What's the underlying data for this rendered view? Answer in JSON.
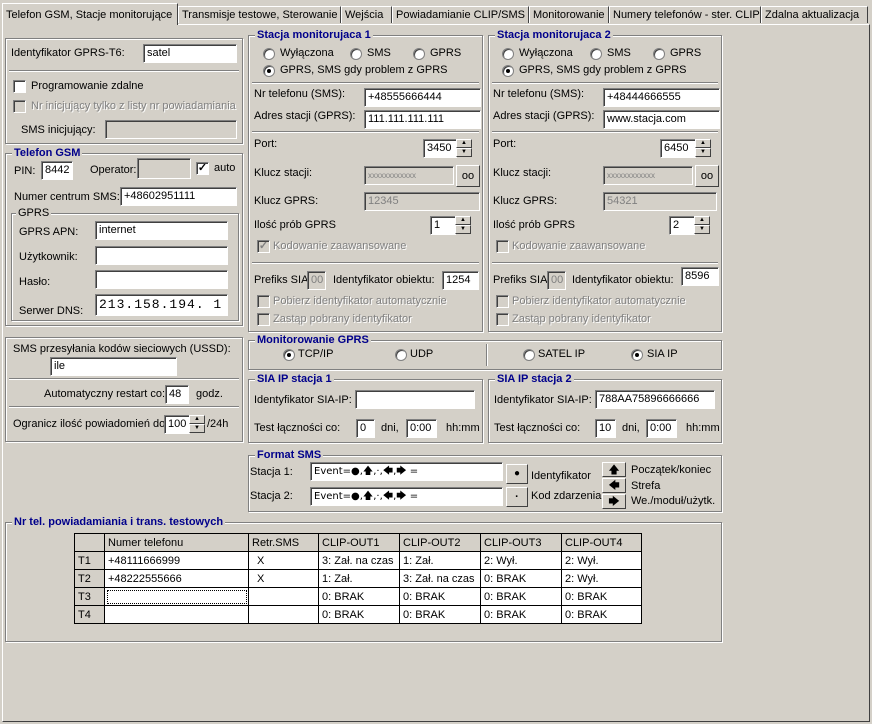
{
  "tabs": [
    "Telefon GSM, Stacje monitorujące",
    "Transmisje testowe, Sterowanie",
    "Wejścia",
    "Powiadamianie CLIP/SMS",
    "Monitorowanie",
    "Numery telefonów - ster. CLIP",
    "Zdalna aktualizacja"
  ],
  "left": {
    "gprs_id_label": "Identyfikator GPRS-T6:",
    "gprs_id_value": "satel",
    "remote_prog_label": "Programowanie zdalne",
    "init_list_label": "Nr inicjujący tylko z listy nr powiadamiania",
    "sms_init_label": "SMS inicjujący:",
    "sms_init_value": ""
  },
  "gsm": {
    "title": "Telefon GSM",
    "pin_label": "PIN:",
    "pin_value": "8442",
    "operator_label": "Operator:",
    "operator_value": "",
    "auto_label": "auto",
    "auto_checked": "✓",
    "center_label": "Numer centrum SMS:",
    "center_value": "+48602951111",
    "gprs_title": "GPRS",
    "apn_label": "GPRS APN:",
    "apn_value": "internet",
    "user_label": "Użytkownik:",
    "user_value": "",
    "pass_label": "Hasło:",
    "pass_value": "",
    "dns_label": "Serwer DNS:",
    "dns_value": "213.158.194.  1"
  },
  "ussd": {
    "label": "SMS przesyłania kodów sieciowych (USSD):",
    "value": "ile"
  },
  "restart": {
    "label": "Automatyczny restart co:",
    "value": "48",
    "unit": "godz."
  },
  "limit": {
    "label": "Ogranicz ilość powiadomień do:",
    "value": "100",
    "unit": "/24h"
  },
  "station1": {
    "title": "Stacja monitorujaca 1",
    "opt_off": "Wyłączona",
    "opt_sms": "SMS",
    "opt_gprs": "GPRS",
    "opt_both": "GPRS, SMS gdy problem z GPRS",
    "phone_label": "Nr telefonu (SMS):",
    "phone_value": "+48555666444",
    "addr_label": "Adres stacji (GPRS):",
    "addr_value": "111.111.111.111",
    "port_label": "Port:",
    "port_value": "3450",
    "key_label": "Klucz stacji:",
    "key_value": "xxxxxxxxxxxx",
    "keygprs_label": "Klucz GPRS:",
    "keygprs_value": "12345",
    "tries_label": "Ilość prób GPRS",
    "tries_value": "1",
    "adv_label": "Kodowanie zaawansowane",
    "prefix_label": "Prefiks SIA:",
    "prefix_value": "00",
    "objid_label": "Identyfikator  obiektu:",
    "objid_value": "1254",
    "getid_label": "Pobierz identyfikator automatycznie",
    "replace_label": "Zastąp pobrany identyfikator"
  },
  "station2": {
    "title": "Stacja monitorujaca 2",
    "opt_off": "Wyłączona",
    "opt_sms": "SMS",
    "opt_gprs": "GPRS",
    "opt_both": "GPRS, SMS gdy problem z GPRS",
    "phone_label": "Nr telefonu (SMS):",
    "phone_value": "+48444666555",
    "addr_label": "Adres stacji (GPRS):",
    "addr_value": "www.stacja.com",
    "port_label": "Port:",
    "port_value": "6450",
    "key_label": "Klucz stacji:",
    "key_value": "xxxxxxxxxxxx",
    "keygprs_label": "Klucz GPRS:",
    "keygprs_value": "54321",
    "tries_label": "Ilość prób GPRS",
    "tries_value": "2",
    "adv_label": "Kodowanie zaawansowane",
    "prefix_label": "Prefiks SIA:",
    "prefix_value": "00",
    "objid_label": "Identyfikator  obiektu:",
    "objid_value": "8596",
    "getid_label": "Pobierz identyfikator automatycznie",
    "replace_label": "Zastąp pobrany identyfikator"
  },
  "monitor_gprs": {
    "title": "Monitorowanie GPRS",
    "tcp": "TCP/IP",
    "udp": "UDP",
    "satel": "SATEL IP",
    "sia": "SIA IP"
  },
  "sia1": {
    "title": "SIA IP stacja 1",
    "id_label": "Identyfikator SIA-IP:",
    "id_value": "",
    "test_label": "Test łączności co:",
    "days_value": "0",
    "days_unit": "dni,",
    "time_value": "0:00",
    "time_unit": "hh:mm"
  },
  "sia2": {
    "title": "SIA IP stacja 2",
    "id_label": "Identyfikator SIA-IP:",
    "id_value": "788AA75896666666",
    "test_label": "Test łączności co:",
    "days_value": "10",
    "days_unit": "dni,",
    "time_value": "0:00",
    "time_unit": "hh:mm"
  },
  "format": {
    "title": "Format SMS",
    "st1_label": "Stacja 1:",
    "st1_value": "Event=●,🡅,·,🡄,🡆 =",
    "st2_label": "Stacja 2:",
    "st2_value": "Event=●,🡅,·,🡄,🡆 =",
    "btn_dot": "●",
    "btn_dot_label": "Identyfikator",
    "btn_mid": "·",
    "btn_mid_label": "Kod zdarzenia",
    "btn_up": "🡅",
    "btn_up_label": "Początek/koniec",
    "btn_left": "🡄",
    "btn_left_label": "Strefa",
    "btn_right": "🡆",
    "btn_right_label": "We./moduł/użytk."
  },
  "notify": {
    "title": "Nr tel. powiadamiania i trans. testowych",
    "headers": [
      "",
      "Numer telefonu",
      "Retr.SMS",
      "CLIP-OUT1",
      "CLIP-OUT2",
      "CLIP-OUT3",
      "CLIP-OUT4"
    ],
    "rows": [
      [
        "T1",
        "+48111666999",
        "X",
        "3: Zał. na czas",
        "1: Zał.",
        "2: Wył.",
        "2: Wył."
      ],
      [
        "T2",
        "+48222555666",
        "X",
        "1: Zał.",
        "3: Zał. na czas",
        "0: BRAK",
        "2: Wył."
      ],
      [
        "T3",
        "",
        "",
        "0: BRAK",
        "0: BRAK",
        "0: BRAK",
        "0: BRAK"
      ],
      [
        "T4",
        "",
        "",
        "0: BRAK",
        "0: BRAK",
        "0: BRAK",
        "0: BRAK"
      ]
    ]
  }
}
